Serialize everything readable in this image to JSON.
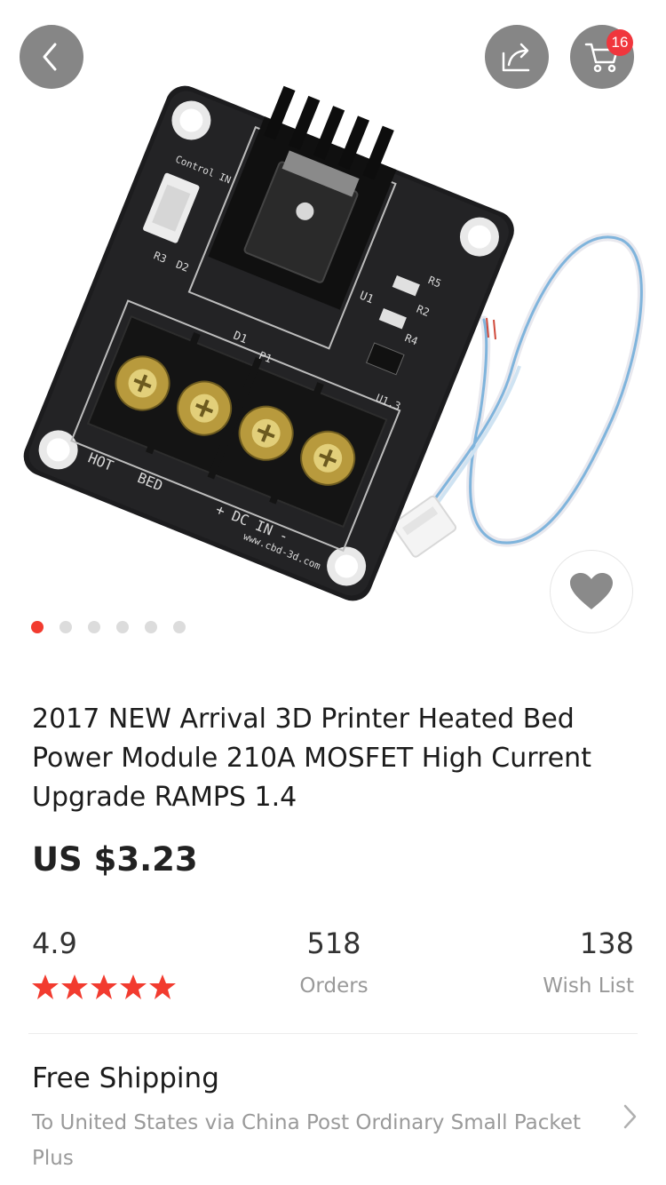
{
  "header": {
    "cart_count": "16",
    "icons": {
      "back": "chevron-left-icon",
      "share": "share-icon",
      "cart": "cart-icon"
    }
  },
  "gallery": {
    "image_count": 6,
    "active_index": 0,
    "board_silkscreen": {
      "terminals": [
        "HOT",
        "BED",
        "+ DC IN -"
      ],
      "labels": [
        "U1",
        "D1",
        "R2",
        "R3",
        "R4",
        "R5",
        "D2",
        "P1",
        "U1.3"
      ],
      "url": "www.cbd-3d.com",
      "control": "Control IN"
    }
  },
  "product": {
    "title": "2017 NEW Arrival 3D Printer Heated Bed Power Module 210A MOSFET High Current Upgrade RAMPS 1.4",
    "price": "US $3.23"
  },
  "stats": {
    "rating": "4.9",
    "stars": 5,
    "orders_value": "518",
    "orders_label": "Orders",
    "wishlist_value": "138",
    "wishlist_label": "Wish List"
  },
  "shipping": {
    "title": "Free Shipping",
    "description": "To United States via China Post Ordinary Small Packet Plus"
  },
  "colors": {
    "accent": "#f23b2f",
    "badge": "#f0363d",
    "muted_text": "#999999"
  }
}
